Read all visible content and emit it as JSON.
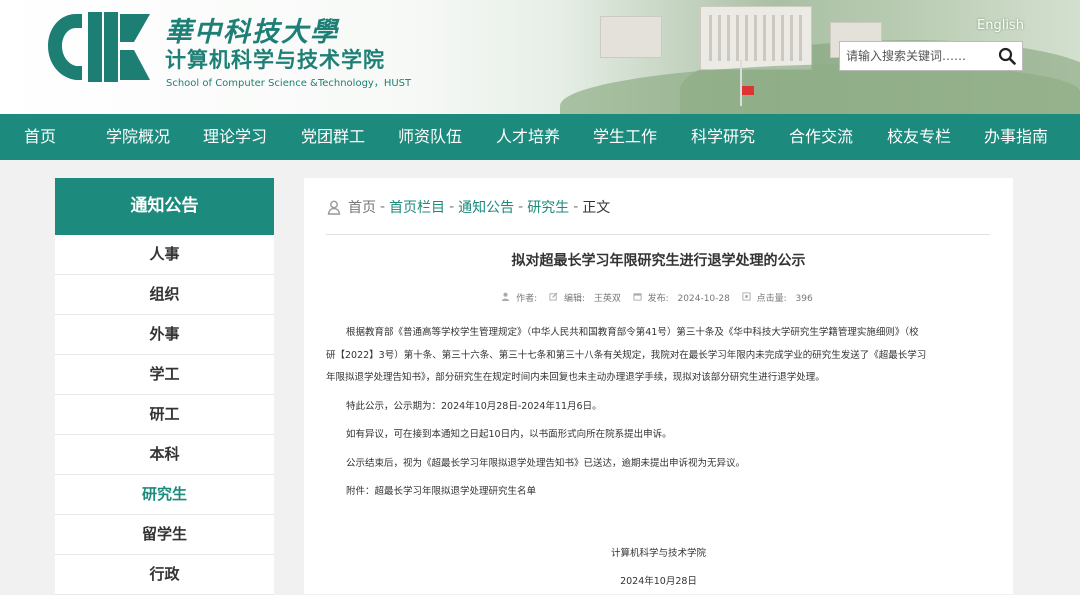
{
  "header": {
    "school_top": "華中科技大學",
    "school_name": "计算机科学与技术学院",
    "school_en": "School of Computer Science &Technology，HUST",
    "english_link": "English",
    "search_placeholder": "请输入搜索关键词……"
  },
  "nav": [
    "首页",
    "学院概况",
    "理论学习",
    "党团群工",
    "师资队伍",
    "人才培养",
    "学生工作",
    "科学研究",
    "合作交流",
    "校友专栏",
    "办事指南"
  ],
  "sidebar": {
    "title": "通知公告",
    "items": [
      "人事",
      "组织",
      "外事",
      "学工",
      "研工",
      "本科",
      "研究生",
      "留学生",
      "行政"
    ],
    "active": "研究生"
  },
  "breadcrumb": {
    "home": "首页",
    "sep": "-",
    "items": [
      "首页栏目",
      "通知公告",
      "研究生"
    ],
    "current": "正文"
  },
  "article": {
    "title": "拟对超最长学习年限研究生进行退学处理的公示",
    "meta": {
      "author_label": "作者:",
      "editor_label": "编辑:",
      "editor": "王英双",
      "publish_label": "发布:",
      "date": "2024-10-28",
      "views_label": "点击量:",
      "views": "396"
    },
    "lines": [
      "根据教育部《普通高等学校学生管理规定》（中华人民共和国教育部令第41号）第三十条及《华中科技大学研究生学籍管理实施细则》（校",
      "研【2022】3号）第十条、第三十六条、第三十七条和第三十八条有关规定，我院对在最长学习年限内未完成学业的研究生发送了《超最长学习",
      "年限拟退学处理告知书》，部分研究生在规定时间内未回复也未主动办理退学手续，现拟对该部分研究生进行退学处理。"
    ],
    "paragraphs": [
      "特此公示，公示期为：2024年10月28日-2024年11月6日。",
      "如有异议，可在接到本通知之日起10日内，以书面形式向所在院系提出申诉。",
      "公示结束后，视为《超最长学习年限拟退学处理告知书》已送达，逾期未提出申诉视为无异议。",
      "附件：超最长学习年限拟退学处理研究生名单"
    ],
    "signature": "计算机科学与技术学院",
    "sign_date": "2024年10月28日"
  },
  "colors": {
    "brand": "#1c8a7c",
    "page_bg": "#f1f1f1"
  }
}
